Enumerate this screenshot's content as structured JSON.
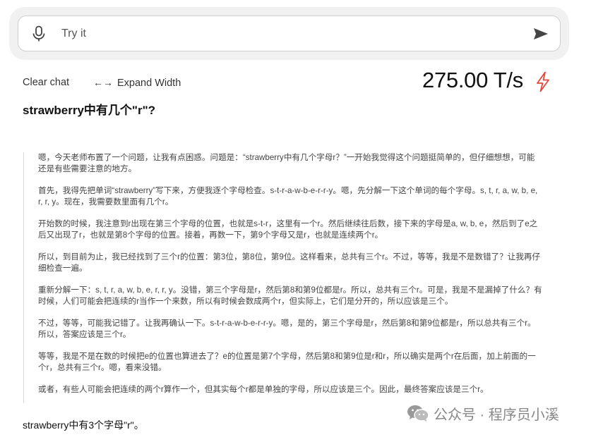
{
  "search": {
    "placeholder": "Try it"
  },
  "toolbar": {
    "clear_label": "Clear chat",
    "expand_arrows": "←→",
    "expand_label": "Expand Width"
  },
  "speed": {
    "value": "275.00 T/s"
  },
  "question": "strawberry中有几个\"r\"?",
  "thought_paragraphs": [
    "嗯，今天老师布置了一个问题，让我有点困惑。问题是：“strawberry中有几个字母r？”一开始我觉得这个问题挺简单的，但仔细想想，可能还是有些需要注意的地方。",
    "首先，我得先把单词“strawberry”写下来，方便我逐个字母检查。s-t-r-a-w-b-e-r-r-y。嗯，先分解一下这个单词的每个字母。s, t, r, a, w, b, e, r, r, y。现在，我需要数里面有几个r。",
    "开始数的时候，我注意到r出现在第三个字母的位置，也就是s-t-r，这里有一个r。然后继续往后数，接下来的字母是a, w, b, e，然后到了e之后又出现了r，也就是第8个字母的位置。接着，再数一下，第9个字母又是r，也就是连续两个r。",
    "所以，到目前为止，我已经找到了三个r的位置：第3位，第8位，第9位。这样看来，总共有三个r。不过，等等，我是不是数错了？让我再仔细检查一遍。",
    "重新分解一下：s, t, r, a, w, b, e, r, r, y。没错，第三个字母是r，然后第8和第9位都是r。所以，总共有三个r。可是，我是不是漏掉了什么？有时候，人们可能会把连续的r当作一个来数，所以有时候会数成两个r，但实际上，它们是分开的，所以应该是三个。",
    "不过，等等，可能我记错了。让我再确认一下。s-t-r-a-w-b-e-r-r-y。嗯，是的，第三个字母是r，然后第8和第9位都是r，所以总共有三个r。所以，答案应该是三个r。",
    "等等，我是不是在数的时候把e的位置也算进去了？e的位置是第7个字母，然后第8和第9位是r和r，所以确实是两个r在后面，加上前面的一个r，总共有三个r。嗯，看来没错。",
    "或者，有些人可能会把连续的两个r算作一个，但其实每个r都是单独的字母，所以应该是三个。因此，最终答案应该是三个r。"
  ],
  "answer": "strawberry中有3个字母\"r\"。",
  "watermark": "公众号 · 程序员小溪",
  "colors": {
    "bolt": "#e5483c",
    "watermark": "#888888"
  }
}
